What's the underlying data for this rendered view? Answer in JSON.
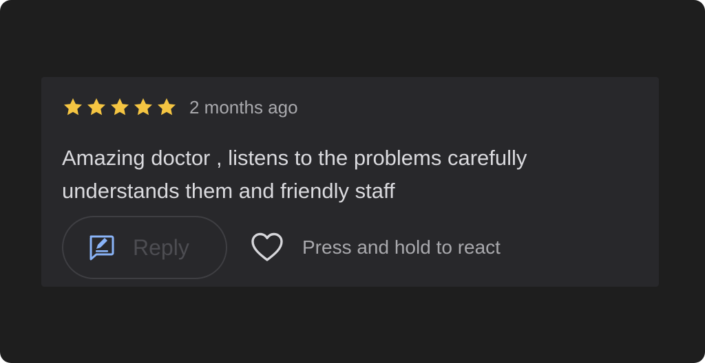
{
  "review": {
    "rating": 5,
    "max_rating": 5,
    "star_color": "#f5c542",
    "time_ago": "2 months ago",
    "text": "Amazing doctor , listens to the problems carefully understands them and friendly staff"
  },
  "actions": {
    "reply_label": "Reply",
    "reply_icon": "reply-edit-icon",
    "reply_icon_color": "#8ab4f8",
    "react_label": "Press and hold to react",
    "react_icon": "heart-outline-icon"
  },
  "colors": {
    "background": "#1e1e1e",
    "card": "#28282b"
  }
}
